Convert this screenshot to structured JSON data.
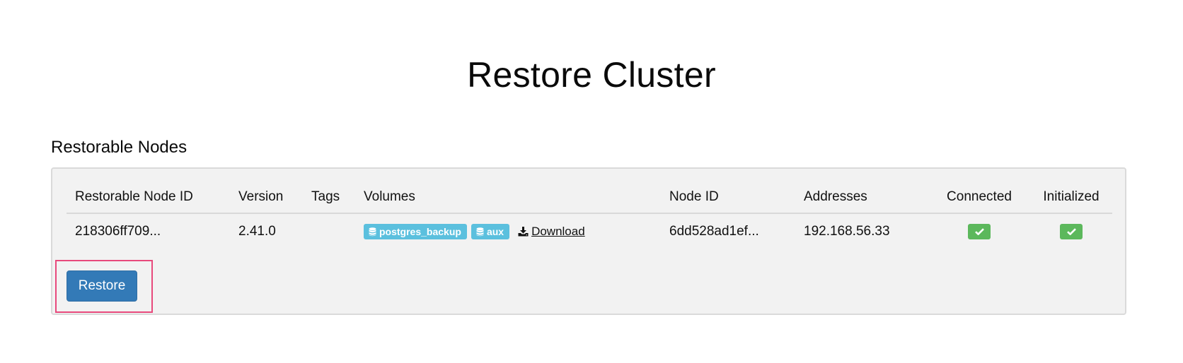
{
  "page": {
    "title": "Restore Cluster"
  },
  "section": {
    "title": "Restorable Nodes"
  },
  "table": {
    "columns": [
      "Restorable Node ID",
      "Version",
      "Tags",
      "Volumes",
      "Node ID",
      "Addresses",
      "Connected",
      "Initialized"
    ],
    "rows": [
      {
        "restorable_node_id": "218306ff709...",
        "version": "2.41.0",
        "tags": "",
        "volumes": [
          {
            "name": "postgres_backup",
            "icon": "database-icon"
          },
          {
            "name": "aux",
            "icon": "database-icon"
          }
        ],
        "download_label": "Download",
        "download_icon": "download-icon",
        "node_id": "6dd528ad1ef...",
        "addresses": "192.168.56.33",
        "connected": true,
        "initialized": true
      }
    ]
  },
  "actions": {
    "restore_label": "Restore"
  },
  "colors": {
    "primary_button": "#337ab7",
    "volume_badge": "#5bc0de",
    "status_ok": "#5cb85c",
    "highlight_outline": "#e8497c",
    "panel_background": "#f2f2f2"
  }
}
